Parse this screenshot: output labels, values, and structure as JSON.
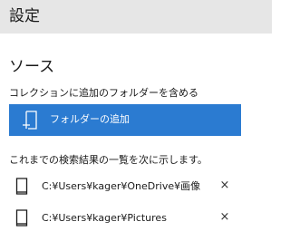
{
  "header": {
    "title": "設定"
  },
  "sources": {
    "title": "ソース",
    "include_description": "コレクションに追加のフォルダーを含める",
    "add_folder_button": {
      "label": "フォルダーの追加",
      "icon": "add-folder-icon",
      "color": "#2b7bd1"
    },
    "list_description": "これまでの検索結果の一覧を次に示します。",
    "folders": [
      {
        "path": "C:¥Users¥kager¥OneDrive¥画像",
        "icon": "document-icon",
        "remove_glyph": "×"
      },
      {
        "path": "C:¥Users¥kager¥Pictures",
        "icon": "document-icon",
        "remove_glyph": "×"
      }
    ]
  },
  "colors": {
    "header_bg": "#e6e6e6",
    "accent": "#2b7bd1",
    "text": "#1a1a1a"
  }
}
